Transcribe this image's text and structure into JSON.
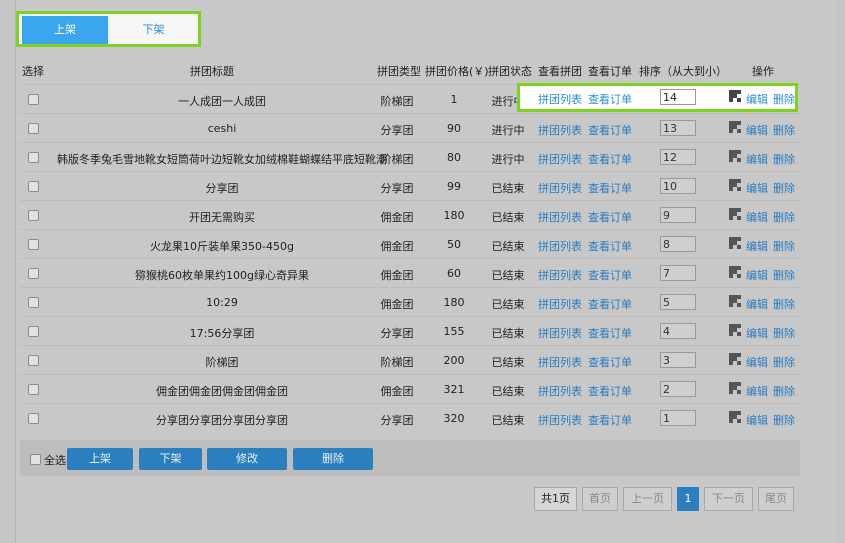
{
  "tabs": {
    "on_label": "上架",
    "off_label": "下架"
  },
  "table": {
    "headers": {
      "select": "选择",
      "title": "拼团标题",
      "type": "拼团类型",
      "price": "拼团价格(￥)",
      "status": "拼团状态",
      "view_group": "查看拼团",
      "view_order": "查看订单",
      "sort": "排序（从大到小）",
      "ops": "操作"
    },
    "link_labels": {
      "group_list": "拼团列表",
      "view_order": "查看订单",
      "edit": "编辑",
      "delete": "删除"
    },
    "rows": [
      {
        "title": "一人成团一人成团",
        "type": "阶梯团",
        "price": "1",
        "status": "进行中",
        "sort": "14"
      },
      {
        "title": "ceshi",
        "type": "分享团",
        "price": "90",
        "status": "进行中",
        "sort": "13"
      },
      {
        "title": "韩版冬季兔毛雪地靴女短筒荷叶边短靴女加绒棉鞋蝴蝶结平底短靴潮",
        "type": "阶梯团",
        "price": "80",
        "status": "进行中",
        "sort": "12"
      },
      {
        "title": "分享团",
        "type": "分享团",
        "price": "99",
        "status": "已结束",
        "sort": "10"
      },
      {
        "title": "开团无需购买",
        "type": "佣金团",
        "price": "180",
        "status": "已结束",
        "sort": "9"
      },
      {
        "title": "火龙果10斤装单果350-450g",
        "type": "佣金团",
        "price": "50",
        "status": "已结束",
        "sort": "8"
      },
      {
        "title": "猕猴桃60枚单果约100g绿心奇异果",
        "type": "佣金团",
        "price": "60",
        "status": "已结束",
        "sort": "7"
      },
      {
        "title": "10:29",
        "type": "佣金团",
        "price": "180",
        "status": "已结束",
        "sort": "5"
      },
      {
        "title": "17:56分享团",
        "type": "分享团",
        "price": "155",
        "status": "已结束",
        "sort": "4"
      },
      {
        "title": "阶梯团",
        "type": "阶梯团",
        "price": "200",
        "status": "已结束",
        "sort": "3"
      },
      {
        "title": "佣金团佣金团佣金团佣金团",
        "type": "佣金团",
        "price": "321",
        "status": "已结束",
        "sort": "2"
      },
      {
        "title": "分享团分享团分享团分享团",
        "type": "分享团",
        "price": "320",
        "status": "已结束",
        "sort": "1"
      }
    ]
  },
  "footer": {
    "select_all": "全选",
    "btn_on": "上架",
    "btn_off": "下架",
    "btn_edit": "修改",
    "btn_delete": "删除"
  },
  "pager": {
    "total": "共1页",
    "first": "首页",
    "prev": "上一页",
    "current": "1",
    "next": "下一页",
    "last": "尾页"
  },
  "colors": {
    "accent": "#2b7fbf",
    "highlight": "#7ed321",
    "link": "#2a7cc0"
  },
  "icons": {
    "qr": "qr-code-icon"
  }
}
